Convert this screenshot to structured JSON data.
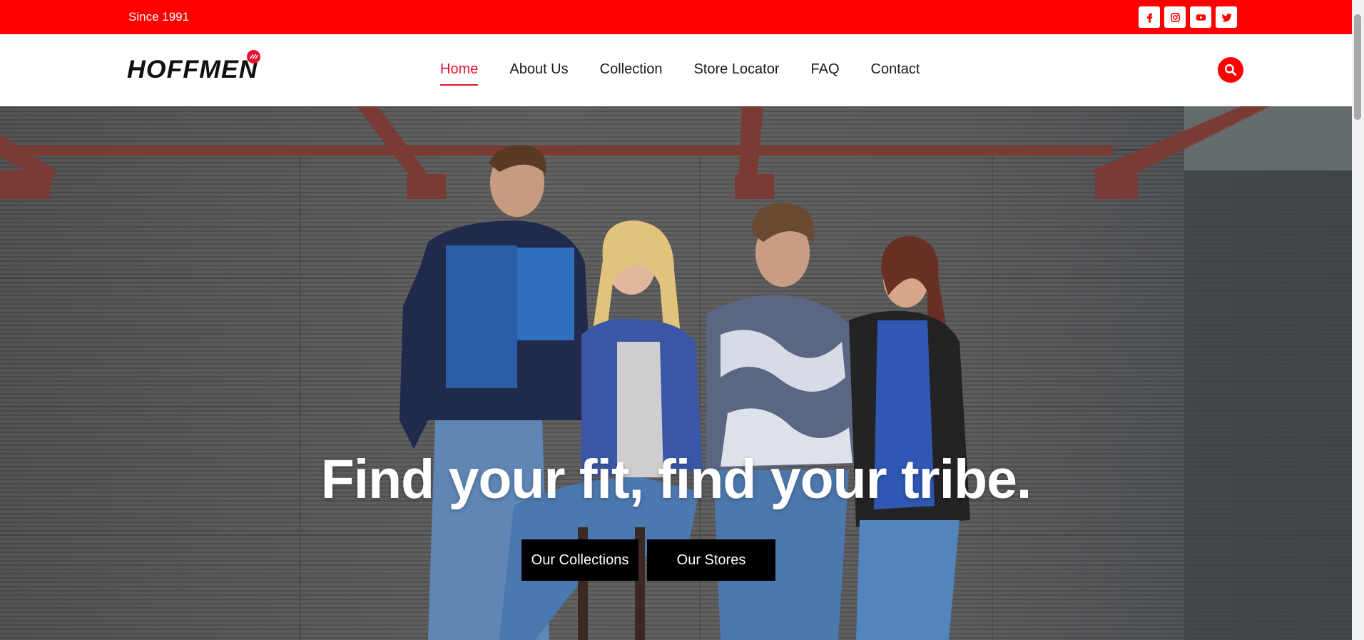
{
  "topbar": {
    "since_text": "Since 1991",
    "background_color": "#ff0000",
    "socials": [
      {
        "name": "facebook-icon"
      },
      {
        "name": "instagram-icon"
      },
      {
        "name": "youtube-icon"
      },
      {
        "name": "twitter-icon"
      }
    ]
  },
  "header": {
    "logo_text": "HOFFMEN",
    "nav": [
      {
        "label": "Home",
        "active": true
      },
      {
        "label": "About Us",
        "active": false
      },
      {
        "label": "Collection",
        "active": false
      },
      {
        "label": "Store Locator",
        "active": false
      },
      {
        "label": "FAQ",
        "active": false
      },
      {
        "label": "Contact",
        "active": false
      }
    ],
    "search_icon": "search-icon",
    "accent_color": "#e8112d"
  },
  "hero": {
    "title": "Find your fit, find your tribe.",
    "buttons": [
      {
        "label": "Our Collections"
      },
      {
        "label": "Our Stores"
      }
    ]
  }
}
